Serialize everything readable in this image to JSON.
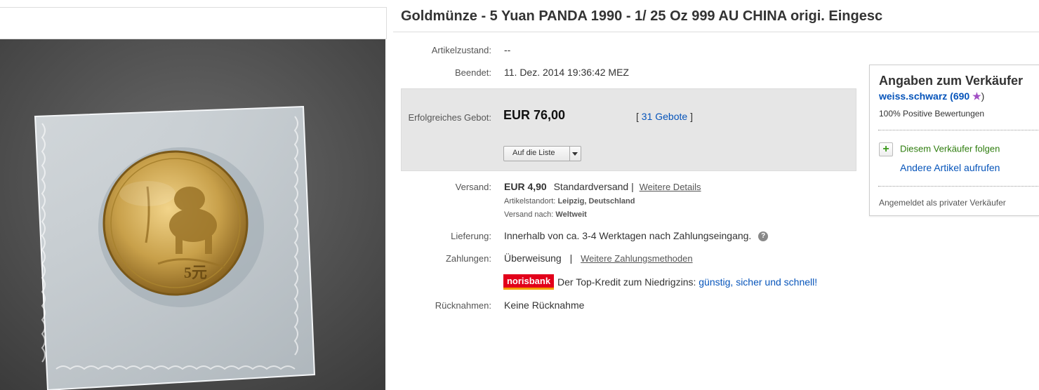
{
  "listing": {
    "title": "Goldmünze - 5 Yuan PANDA 1990 - 1/ 25 Oz 999 AU CHINA origi. Eingesc",
    "photo_alt": "Goldmünze Panda 5 Yuan",
    "coin_face_value": "5元"
  },
  "details": {
    "condition_label": "Artikelzustand:",
    "condition_value": "--",
    "ended_label": "Beendet:",
    "ended_value": "11. Dez. 2014  19:36:42 MEZ",
    "winning_bid_label": "Erfolgreiches Gebot:",
    "winning_bid_value": "EUR 76,00",
    "bids_open": "[",
    "bids_link": "31 Gebote",
    "bids_close": "]",
    "watch_button": "Auf die Liste",
    "shipping_label": "Versand:",
    "shipping_price": "EUR 4,90",
    "shipping_method": "Standardversand |",
    "shipping_more": "Weitere Details",
    "location_label": "Artikelstandort:",
    "location_value": "Leipzig, Deutschland",
    "ships_to_label": "Versand nach:",
    "ships_to_value": "Weltweit",
    "delivery_label": "Lieferung:",
    "delivery_value": "Innerhalb von ca. 3-4 Werktagen nach Zahlungseingang.",
    "help_icon": "?",
    "payment_label": "Zahlungen:",
    "payment_value": "Überweisung",
    "payment_sep": "|",
    "payment_more": "Weitere Zahlungsmethoden",
    "norisbank_logo": "norisbank",
    "norisbank_text": "Der Top-Kredit zum Niedrigzins:",
    "norisbank_link": "günstig, sicher und schnell!",
    "returns_label": "Rücknahmen:",
    "returns_value": "Keine Rücknahme"
  },
  "seller": {
    "heading": "Angaben zum Verkäufer",
    "name": "weiss.schwarz",
    "score_open": "(690",
    "score_close": ")",
    "positive": "100% Positive Bewertungen",
    "follow": "Diesem Verkäufer folgen",
    "other_items": "Andere Artikel aufrufen",
    "private": "Angemeldet als privater Verkäufer"
  },
  "colors": {
    "link": "#0654ba",
    "star": "#a14fc4",
    "follow_green": "#2e7d0e",
    "bidbox_bg": "#e6e6e6"
  }
}
